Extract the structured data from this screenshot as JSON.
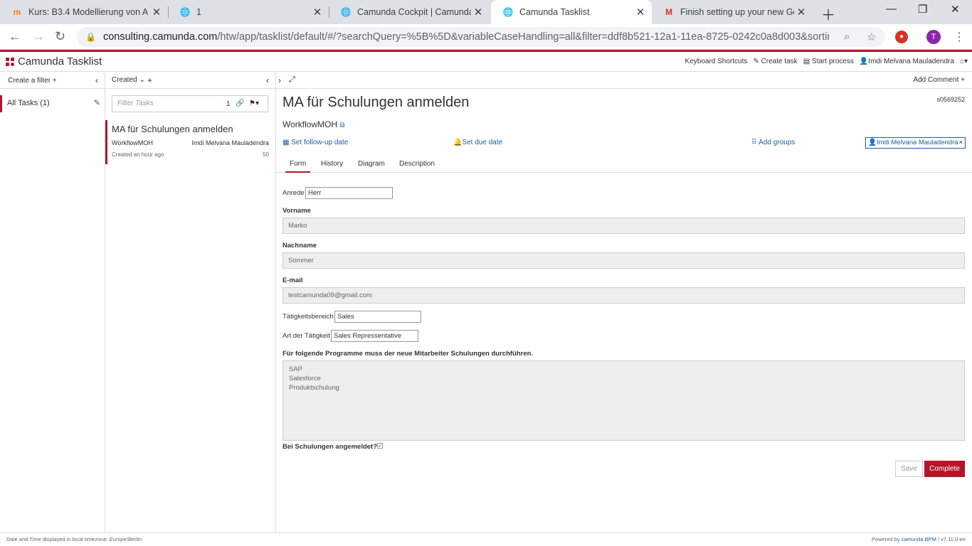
{
  "browser": {
    "tabs": [
      {
        "title": "Kurs: B3.4 Modellierung von A",
        "icon": "moodle-icon"
      },
      {
        "title": "1",
        "icon": "globe-icon"
      },
      {
        "title": "Camunda Cockpit | Camunda C",
        "icon": "globe-icon"
      },
      {
        "title": "Camunda Tasklist",
        "icon": "globe-icon"
      },
      {
        "title": "Finish setting up your new Goo",
        "icon": "gmail-icon"
      }
    ],
    "url_host": "consulting.camunda.com",
    "url_path": "/htw/app/tasklist/default/#/?searchQuery=%5B%5D&variableCaseHandling=all&filter=ddf8b521-12a1-11ea-8725-0242c0a8d003&sorting=...",
    "profile_initial": "T"
  },
  "app": {
    "title": "Camunda Tasklist",
    "brand_color": "#b5152b",
    "header_links": [
      "Keyboard Shortcuts",
      "Create task",
      "Start process",
      "Imdi Melvana Mauladendra"
    ]
  },
  "filters": {
    "create_label": "Create a filter",
    "items": [
      {
        "label": "All Tasks (1)"
      }
    ]
  },
  "list": {
    "sort_label": "Created",
    "filter_placeholder": "Filter Tasks",
    "filter_count": "1",
    "tasks": [
      {
        "name": "MA für Schulungen anmelden",
        "process": "WorkflowMOH",
        "assignee": "Imdi Melvana Mauladendra",
        "created": "Created an hour ago",
        "priority": "50"
      }
    ]
  },
  "detail": {
    "add_comment": "Add Comment",
    "title": "MA für Schulungen anmelden",
    "process": "WorkflowMOH",
    "task_id": "s0569252",
    "actions": {
      "follow_up": "Set follow-up date",
      "due": "Set due date",
      "groups": "Add groups"
    },
    "assignee": "Imdi Melvana Mauladendra",
    "tabs": [
      "Form",
      "History",
      "Diagram",
      "Description"
    ],
    "form": {
      "anrede_label": "Anrede",
      "anrede_value": "Herr",
      "vorname_label": "Vorname",
      "vorname_value": "Marko",
      "nachname_label": "Nachname",
      "nachname_value": "Sommer",
      "email_label": "E-mail",
      "email_value": "testcamunda09@gmail.com",
      "bereich_label": "Tätigkeitsbereich",
      "bereich_value": "Sales",
      "art_label": "Art der Tätigkeit",
      "art_value": "Sales Repressentative",
      "programs_label": "Für folgende Programme muss der neue Mitarbeiter Schulungen durchführen.",
      "programs": [
        "SAP",
        "Salesforce",
        "Produktschulung"
      ],
      "checkbox_label": "Bei Schulungen angemeldet?",
      "checkbox_checked": true,
      "save_label": "Save",
      "complete_label": "Complete"
    }
  },
  "footer": {
    "left": "Date and Time displayed in local timezone:",
    "tz": "Europe/Berlin",
    "right_prefix": "Powered by",
    "right_link": "camunda BPM",
    "version": "/ v7.11.0-ee"
  }
}
